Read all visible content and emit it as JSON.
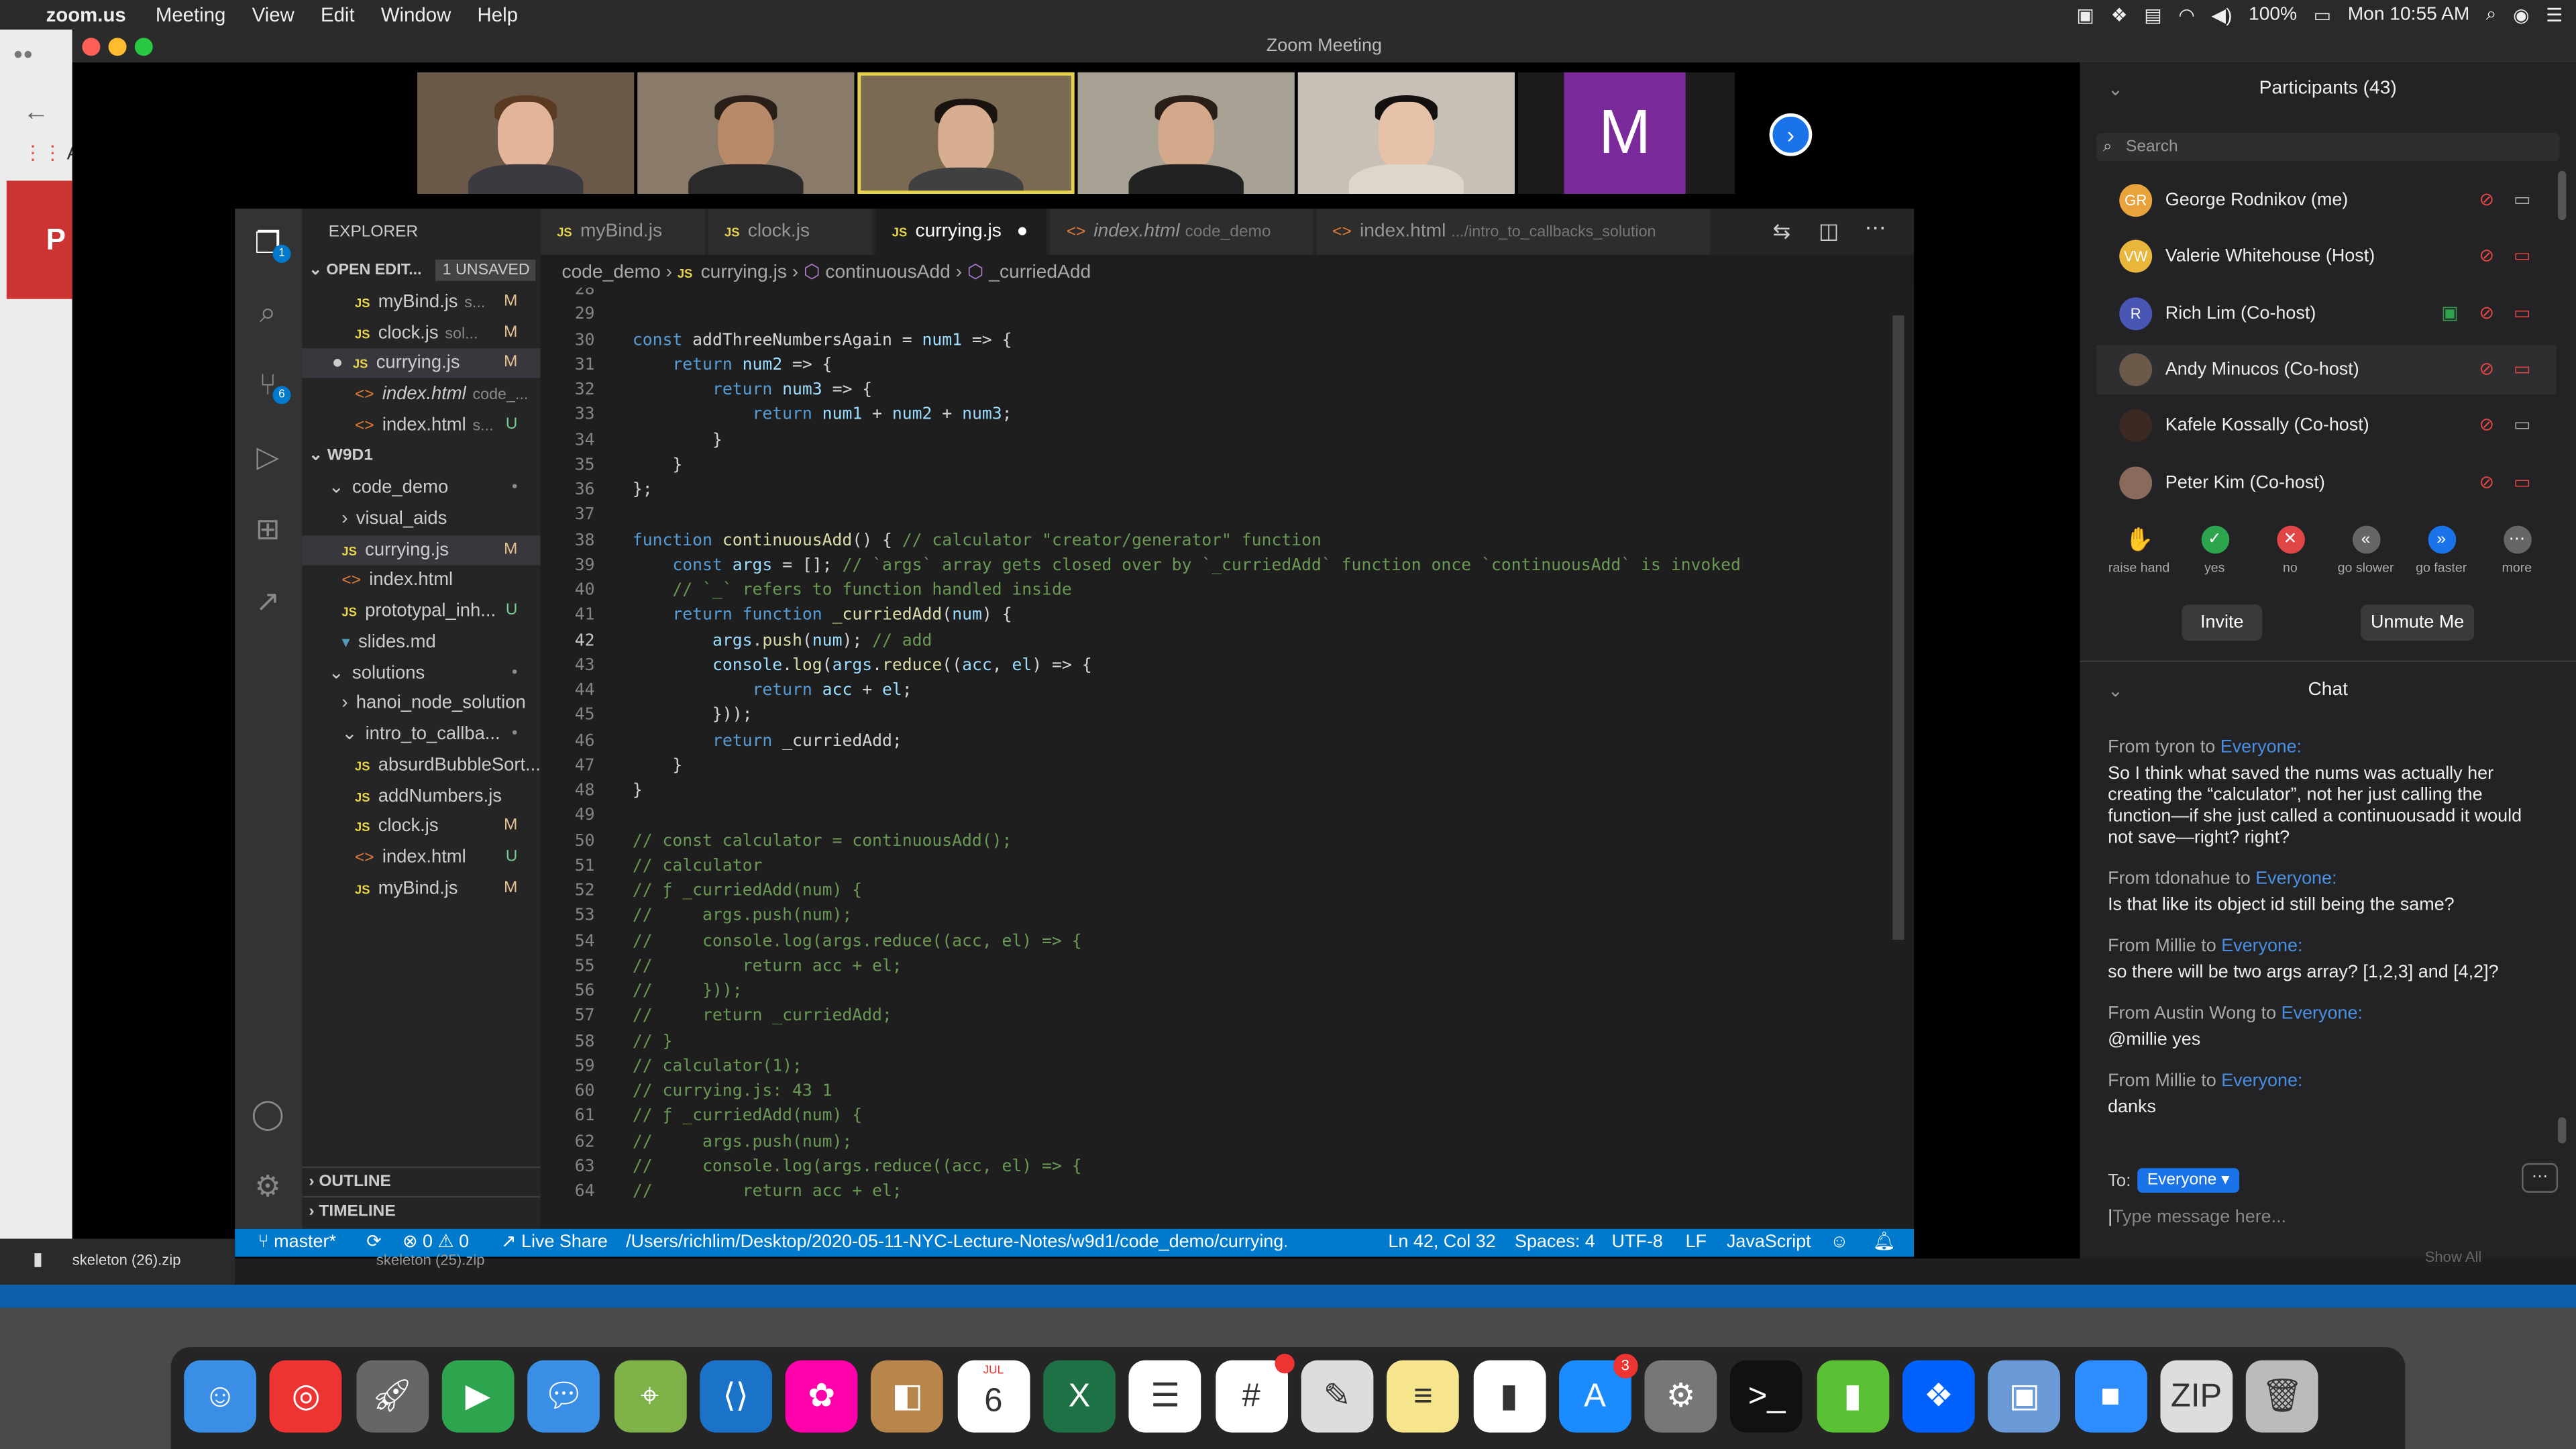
{
  "menubar": {
    "app": "zoom.us",
    "items": [
      "Meeting",
      "View",
      "Edit",
      "Window",
      "Help"
    ],
    "battery": "100%",
    "clock": "Mon 10:55 AM"
  },
  "window": {
    "title": "Zoom Meeting"
  },
  "thumbnails": {
    "m_letter": "M"
  },
  "vscode": {
    "explorer_title": "EXPLORER",
    "open_editors": "OPEN EDIT...",
    "unsaved": "1 UNSAVED",
    "open_files": [
      {
        "name": "myBind.js",
        "sub": "s...",
        "mark": "M",
        "kind": "js"
      },
      {
        "name": "clock.js",
        "sub": "sol...",
        "mark": "M",
        "kind": "js"
      },
      {
        "name": "currying.js",
        "sub": "",
        "mark": "M",
        "kind": "js"
      },
      {
        "name": "index.html",
        "sub": "code_...",
        "mark": "",
        "kind": "html"
      },
      {
        "name": "index.html",
        "sub": "s...",
        "mark": "U",
        "kind": "html"
      }
    ],
    "root": "W9D1",
    "tree": [
      {
        "name": "code_demo",
        "indent": 1,
        "kind": "folder",
        "mark": "•"
      },
      {
        "name": "visual_aids",
        "indent": 2,
        "kind": "folder-closed",
        "mark": ""
      },
      {
        "name": "currying.js",
        "indent": 2,
        "kind": "js",
        "mark": "M"
      },
      {
        "name": "index.html",
        "indent": 2,
        "kind": "html",
        "mark": ""
      },
      {
        "name": "prototypal_inh...",
        "indent": 2,
        "kind": "js",
        "mark": "U"
      },
      {
        "name": "slides.md",
        "indent": 2,
        "kind": "md",
        "mark": ""
      },
      {
        "name": "solutions",
        "indent": 1,
        "kind": "folder",
        "mark": "•"
      },
      {
        "name": "hanoi_node_solution",
        "indent": 2,
        "kind": "folder-closed",
        "mark": ""
      },
      {
        "name": "intro_to_callba...",
        "indent": 2,
        "kind": "folder",
        "mark": "•"
      },
      {
        "name": "absurdBubbleSort...",
        "indent": 3,
        "kind": "js",
        "mark": ""
      },
      {
        "name": "addNumbers.js",
        "indent": 3,
        "kind": "js",
        "mark": ""
      },
      {
        "name": "clock.js",
        "indent": 3,
        "kind": "js",
        "mark": "M"
      },
      {
        "name": "index.html",
        "indent": 3,
        "kind": "html",
        "mark": "U"
      },
      {
        "name": "myBind.js",
        "indent": 3,
        "kind": "js",
        "mark": "M"
      }
    ],
    "outline": "OUTLINE",
    "timeline": "TIMELINE",
    "tabs": [
      {
        "label": "myBind.js",
        "sub": ""
      },
      {
        "label": "clock.js",
        "sub": ""
      },
      {
        "label": "currying.js",
        "sub": ""
      },
      {
        "label": "index.html",
        "sub": "code_demo"
      },
      {
        "label": "index.html",
        "sub": ".../intro_to_callbacks_solution"
      }
    ],
    "breadcrumb": [
      "code_demo",
      "currying.js",
      "continuousAdd",
      "_curriedAdd"
    ],
    "lines": [
      {
        "n": "28",
        "t": ""
      },
      {
        "n": "29",
        "t": ""
      },
      {
        "n": "30",
        "t": "const addThreeNumbersAgain = num1 => {"
      },
      {
        "n": "31",
        "t": "    return num2 => {"
      },
      {
        "n": "32",
        "t": "        return num3 => {"
      },
      {
        "n": "33",
        "t": "            return num1 + num2 + num3;"
      },
      {
        "n": "34",
        "t": "        }"
      },
      {
        "n": "35",
        "t": "    }"
      },
      {
        "n": "36",
        "t": "};"
      },
      {
        "n": "37",
        "t": ""
      },
      {
        "n": "38",
        "t": "function continuousAdd() { // calculator \"creator/generator\" function"
      },
      {
        "n": "39",
        "t": "    const args = []; // `args` array gets closed over by `_curriedAdd` function once `continuousAdd` is invoked"
      },
      {
        "n": "40",
        "t": "    // `_` refers to function handled inside"
      },
      {
        "n": "41",
        "t": "    return function _curriedAdd(num) {"
      },
      {
        "n": "42",
        "t": "        args.push(num); // add"
      },
      {
        "n": "43",
        "t": "        console.log(args.reduce((acc, el) => {"
      },
      {
        "n": "44",
        "t": "            return acc + el;"
      },
      {
        "n": "45",
        "t": "        }));"
      },
      {
        "n": "46",
        "t": "        return _curriedAdd;"
      },
      {
        "n": "47",
        "t": "    }"
      },
      {
        "n": "48",
        "t": "}"
      },
      {
        "n": "49",
        "t": ""
      },
      {
        "n": "50",
        "t": "// const calculator = continuousAdd();"
      },
      {
        "n": "51",
        "t": "// calculator"
      },
      {
        "n": "52",
        "t": "// ƒ _curriedAdd(num) {"
      },
      {
        "n": "53",
        "t": "//     args.push(num);"
      },
      {
        "n": "54",
        "t": "//     console.log(args.reduce((acc, el) => {"
      },
      {
        "n": "55",
        "t": "//         return acc + el;"
      },
      {
        "n": "56",
        "t": "//     }));"
      },
      {
        "n": "57",
        "t": "//     return _curriedAdd;"
      },
      {
        "n": "58",
        "t": "// }"
      },
      {
        "n": "59",
        "t": "// calculator(1);"
      },
      {
        "n": "60",
        "t": "// currying.js: 43 1"
      },
      {
        "n": "61",
        "t": "// ƒ _curriedAdd(num) {"
      },
      {
        "n": "62",
        "t": "//     args.push(num);"
      },
      {
        "n": "63",
        "t": "//     console.log(args.reduce((acc, el) => {"
      },
      {
        "n": "64",
        "t": "//         return acc + el;"
      }
    ],
    "status": {
      "branch": "master*",
      "problems": "⊗ 0 ⚠ 0",
      "liveshare": "Live Share",
      "path": "/Users/richlim/Desktop/2020-05-11-NYC-Lecture-Notes/w9d1/code_demo/currying.js",
      "pos": "Ln 42, Col 32",
      "spaces": "Spaces: 4",
      "enc": "UTF-8",
      "eol": "LF",
      "lang": "JavaScript"
    }
  },
  "participants": {
    "title": "Participants (43)",
    "search_placeholder": "Search",
    "list": [
      {
        "initials": "GR",
        "name": "George Rodnikov (me)",
        "color": "#e8a33c"
      },
      {
        "initials": "VW",
        "name": "Valerie Whitehouse (Host)",
        "color": "#e8b73c"
      },
      {
        "initials": "R",
        "name": "Rich Lim (Co-host)",
        "color": "#4a56b4"
      },
      {
        "initials": "",
        "name": "Andy Minucos (Co-host)",
        "color": "#6b5a4a"
      },
      {
        "initials": "",
        "name": "Kafele Kossally (Co-host)",
        "color": "#3b2a22"
      },
      {
        "initials": "",
        "name": "Peter Kim (Co-host)",
        "color": "#8a6a5a"
      }
    ],
    "reactions": [
      {
        "label": "raise hand",
        "glyph": "✋",
        "color": "transparent"
      },
      {
        "label": "yes",
        "glyph": "✓",
        "color": "#2da44e"
      },
      {
        "label": "no",
        "glyph": "✕",
        "color": "#e04646"
      },
      {
        "label": "go slower",
        "glyph": "«",
        "color": "#666"
      },
      {
        "label": "go faster",
        "glyph": "»",
        "color": "#1a73e8"
      },
      {
        "label": "more",
        "glyph": "⋯",
        "color": "#666"
      }
    ],
    "invite": "Invite",
    "unmute": "Unmute Me"
  },
  "chat": {
    "title": "Chat",
    "messages": [
      {
        "from": "From tyron to ",
        "to": "Everyone:",
        "text": "So I think what saved the nums was actually her creating the “calculator”, not her just calling the function—if she just called a continuousadd it would not save—right? right?"
      },
      {
        "from": "From tdonahue to ",
        "to": "Everyone:",
        "text": "Is that like its object id still being the same?"
      },
      {
        "from": "From Millie to ",
        "to": "Everyone:",
        "text": "so there will be two args array? [1,2,3] and [4,2]?"
      },
      {
        "from": "From Austin Wong to ",
        "to": "Everyone:",
        "text": "@millie yes"
      },
      {
        "from": "From Millie to ",
        "to": "Everyone:",
        "text": "danks"
      }
    ],
    "to_label": "To:",
    "to_value": "Everyone",
    "input_placeholder": "Type message here..."
  },
  "downloads": {
    "file1": "skeleton (26).zip",
    "file2": "skeleton (25).zip",
    "show_all": "Show All"
  },
  "dock": {
    "calendar_month": "JUL",
    "calendar_day": "6",
    "appstore_badge": "3"
  }
}
